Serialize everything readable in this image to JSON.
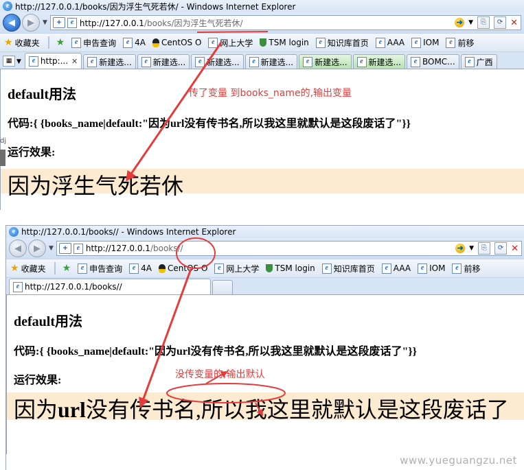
{
  "top_window": {
    "title": "http://127.0.0.1/books/因为浮生气死若休/ - Windows Internet Explorer",
    "url_host": "http://127.0.0.1",
    "url_path": "/books/因为浮生气死若休/",
    "favorites_label": "收藏夹",
    "favorites": [
      "申告查询",
      "4A",
      "CentOS O",
      "网上大学",
      "TSM login",
      "知识库首页",
      "AAA",
      "IOM",
      "前移"
    ],
    "tabs": [
      "http:...",
      "新建选...",
      "新建选...",
      "新建选...",
      "新建选...",
      "新建选...",
      "新建选...",
      "BOMC...",
      "广西"
    ],
    "heading": "default用法",
    "code_line": "代码:{ {books_name|default:\"因为url没有传书名,所以我这里就默认是这段废话了\"}}",
    "run_label": "运行效果:",
    "result": "因为浮生气死若休",
    "annotation": "传了变量 到books_name的,输出变量"
  },
  "bottom_window": {
    "title": "http://127.0.0.1/books// - Windows Internet Explorer",
    "url_host": "http://127.0.0.1",
    "url_path": "/books//",
    "favorites_label": "收藏夹",
    "favorites": [
      "申告查询",
      "4A",
      "CentOS O",
      "网上大学",
      "TSM login",
      "知识库首页",
      "AAA",
      "IOM",
      "前移"
    ],
    "tab": "http://127.0.0.1/books//",
    "heading": "default用法",
    "code_line": "代码:{ {books_name|default:\"因为url没有传书名,所以我这里就默认是这段废话了\"}}",
    "run_label": "运行效果:",
    "result_prefix": "因为",
    "result_bold": "url",
    "result_suffix": "没有传书名,所以我这里就默认是这段废话了",
    "annotation": "没传变量的,输出默认"
  },
  "watermark": "www.yueguangzu.net",
  "colors": {
    "annotation": "#e53b3b",
    "result_bg": "#fcebd1"
  }
}
